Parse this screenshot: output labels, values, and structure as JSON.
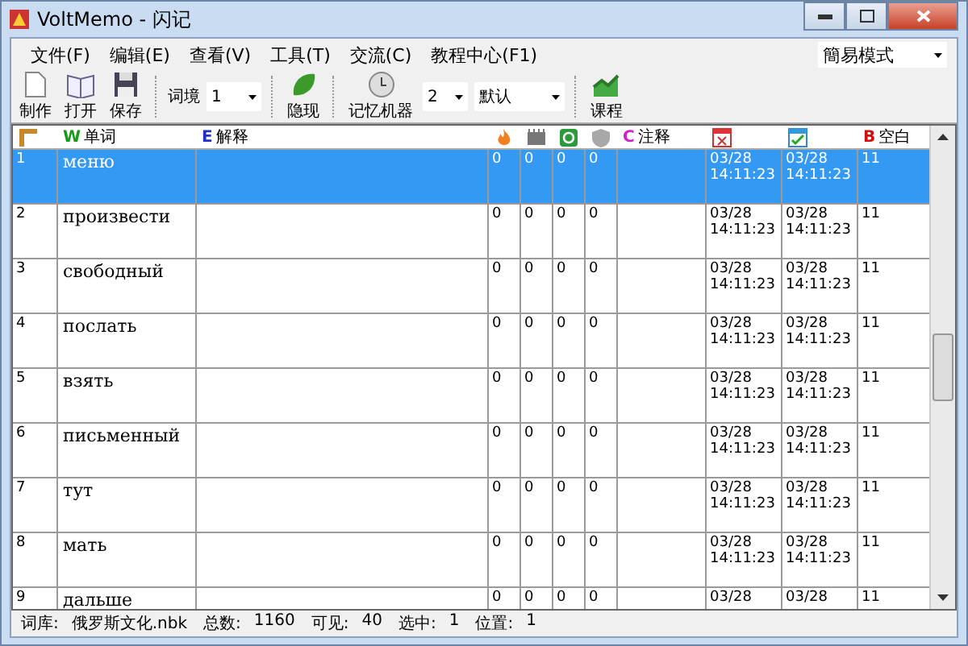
{
  "window": {
    "title": "VoltMemo - 闪记"
  },
  "menu": [
    "文件(F)",
    "编辑(E)",
    "查看(V)",
    "工具(T)",
    "交流(C)",
    "教程中心(F1)"
  ],
  "mode_select": {
    "value": "簡易模式"
  },
  "toolbar": {
    "file_buttons": [
      "制作",
      "打开",
      "保存"
    ],
    "context_label": "词境",
    "context_select": "1",
    "toggle_button": "隐现",
    "memory_button": "记忆机器",
    "memory_select": "2",
    "preset_select": "默认",
    "course_button": "课程"
  },
  "columns": [
    {
      "kind": "icon"
    },
    {
      "kind": "text",
      "badge": "W",
      "label": "单词",
      "color": "#1a9a1a"
    },
    {
      "kind": "text",
      "badge": "E",
      "label": "解释",
      "color": "#2030c0"
    },
    {
      "kind": "icon"
    },
    {
      "kind": "icon"
    },
    {
      "kind": "icon"
    },
    {
      "kind": "icon"
    },
    {
      "kind": "text",
      "badge": "C",
      "label": "注释",
      "color": "#d020d0"
    },
    {
      "kind": "icon"
    },
    {
      "kind": "icon"
    },
    {
      "kind": "text",
      "badge": "B",
      "label": "空白",
      "color": "#d01010"
    }
  ],
  "rows": [
    {
      "num": "1",
      "word": "меню",
      "counts": [
        "0",
        "0",
        "0",
        "0"
      ],
      "date1": "03/28",
      "time1": "14:11:23",
      "date2": "03/28",
      "time2": "14:11:23",
      "blank": "11",
      "selected": true
    },
    {
      "num": "2",
      "word": "произвести",
      "counts": [
        "0",
        "0",
        "0",
        "0"
      ],
      "date1": "03/28",
      "time1": "14:11:23",
      "date2": "03/28",
      "time2": "14:11:23",
      "blank": "11",
      "selected": false
    },
    {
      "num": "3",
      "word": "свободный",
      "counts": [
        "0",
        "0",
        "0",
        "0"
      ],
      "date1": "03/28",
      "time1": "14:11:23",
      "date2": "03/28",
      "time2": "14:11:23",
      "blank": "11",
      "selected": false
    },
    {
      "num": "4",
      "word": "послать",
      "counts": [
        "0",
        "0",
        "0",
        "0"
      ],
      "date1": "03/28",
      "time1": "14:11:23",
      "date2": "03/28",
      "time2": "14:11:23",
      "blank": "11",
      "selected": false
    },
    {
      "num": "5",
      "word": "взять",
      "counts": [
        "0",
        "0",
        "0",
        "0"
      ],
      "date1": "03/28",
      "time1": "14:11:23",
      "date2": "03/28",
      "time2": "14:11:23",
      "blank": "11",
      "selected": false
    },
    {
      "num": "6",
      "word": "письменный",
      "counts": [
        "0",
        "0",
        "0",
        "0"
      ],
      "date1": "03/28",
      "time1": "14:11:23",
      "date2": "03/28",
      "time2": "14:11:23",
      "blank": "11",
      "selected": false
    },
    {
      "num": "7",
      "word": "тут",
      "counts": [
        "0",
        "0",
        "0",
        "0"
      ],
      "date1": "03/28",
      "time1": "14:11:23",
      "date2": "03/28",
      "time2": "14:11:23",
      "blank": "11",
      "selected": false
    },
    {
      "num": "8",
      "word": "мать",
      "counts": [
        "0",
        "0",
        "0",
        "0"
      ],
      "date1": "03/28",
      "time1": "14:11:23",
      "date2": "03/28",
      "time2": "14:11:23",
      "blank": "11",
      "selected": false
    },
    {
      "num": "9",
      "word": "дальше",
      "counts": [
        "0",
        "0",
        "0",
        "0"
      ],
      "date1": "03/28",
      "date2": "03/28",
      "blank": "11",
      "selected": false
    }
  ],
  "status_bar": [
    {
      "label": "词库:",
      "value": "俄罗斯文化.nbk"
    },
    {
      "label": "总数:",
      "value": "1160"
    },
    {
      "label": "可见:",
      "value": "40"
    },
    {
      "label": "选中:",
      "value": "1"
    },
    {
      "label": "位置:",
      "value": "1"
    }
  ]
}
